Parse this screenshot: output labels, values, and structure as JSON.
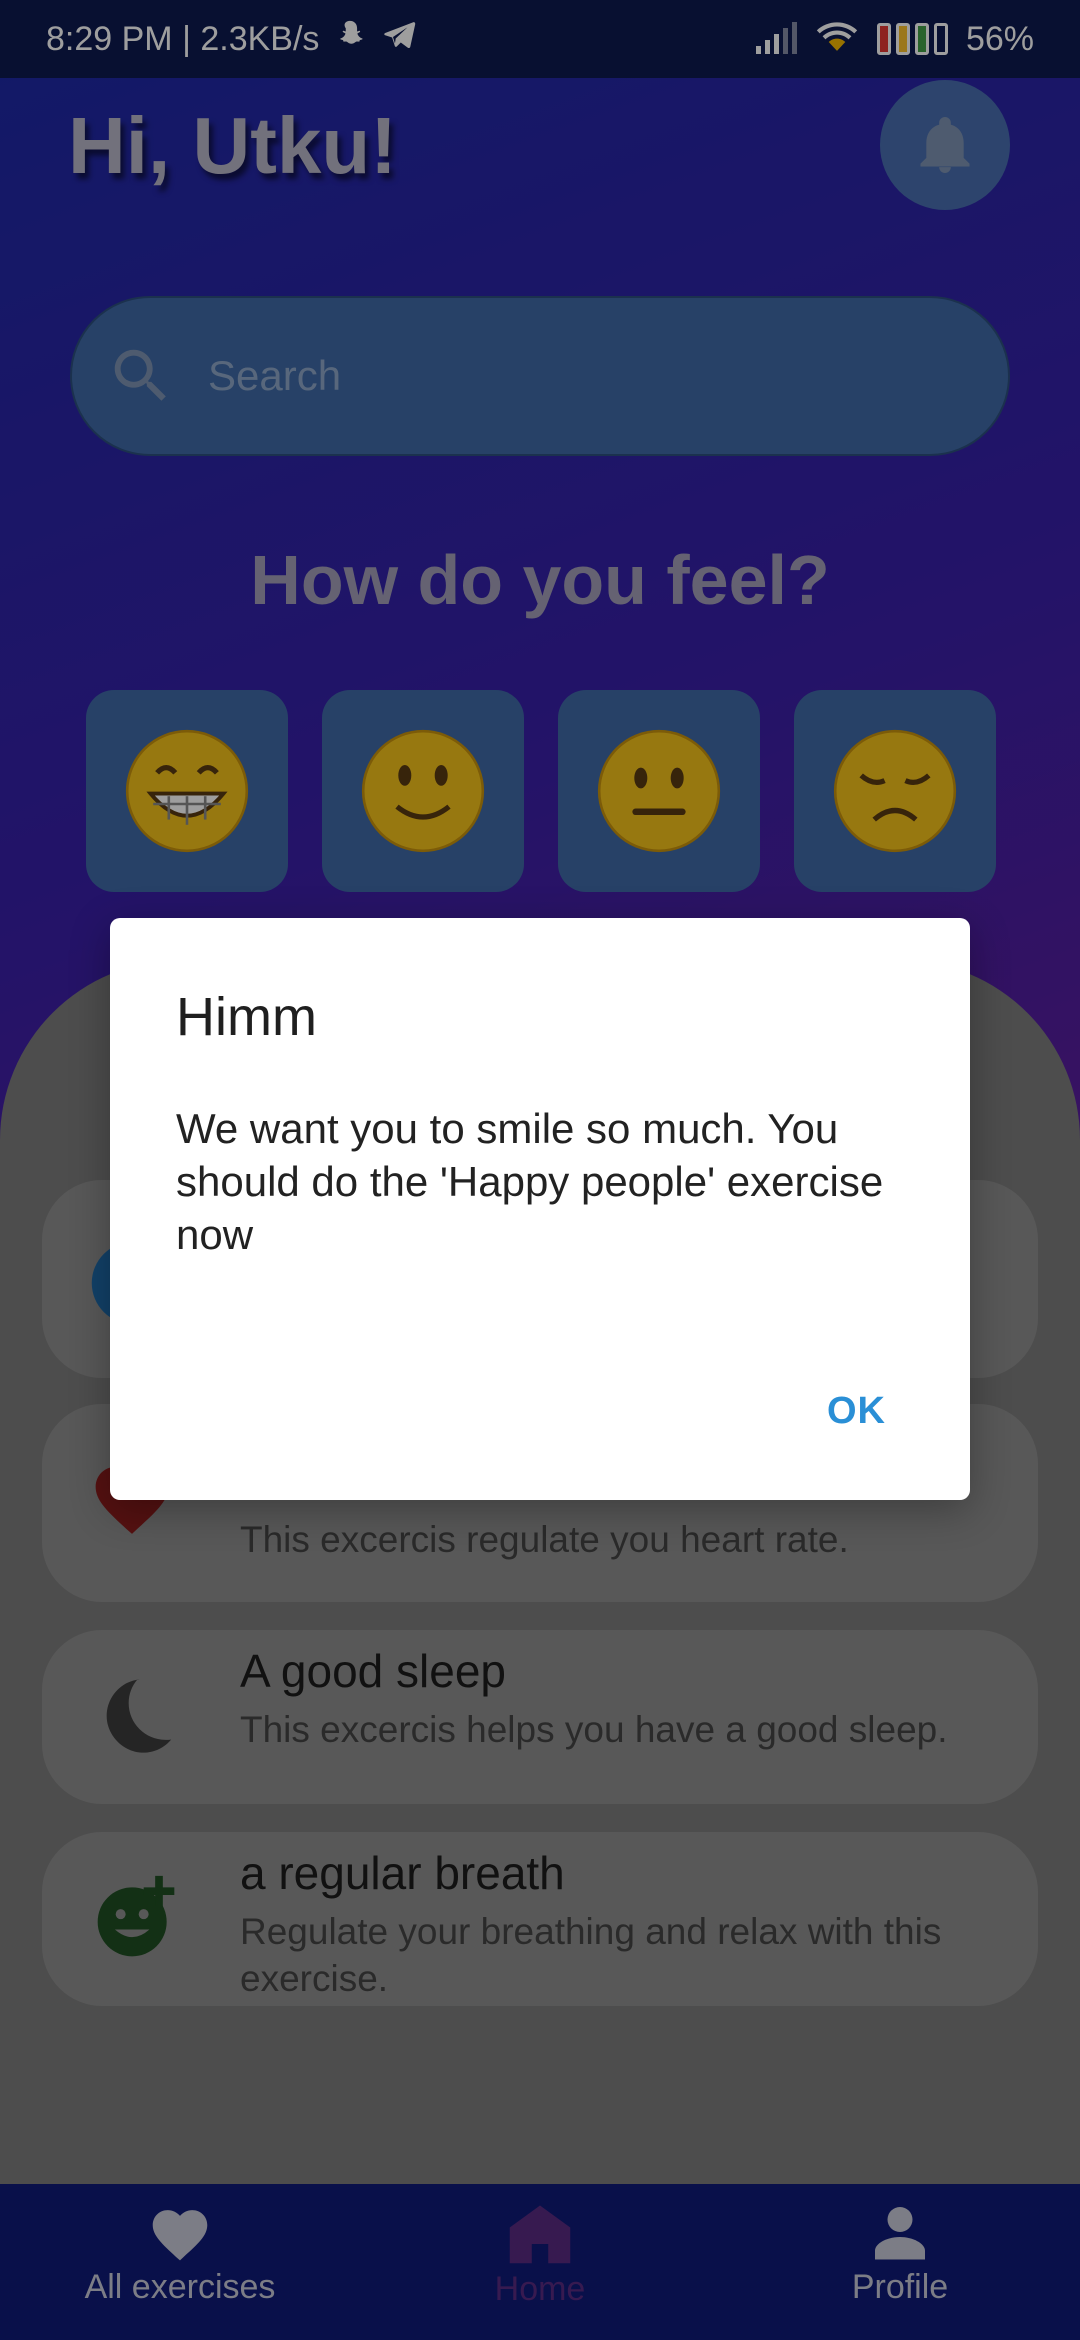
{
  "status_bar": {
    "time_speed": "8:29 PM | 2.3KB/s",
    "battery": "56%"
  },
  "header": {
    "greeting": "Hi, Utku!"
  },
  "search": {
    "placeholder": "Search"
  },
  "mood": {
    "title": "How do you feel?",
    "options": [
      "😁",
      "🙂",
      "😐",
      "😞"
    ]
  },
  "exercises": [
    {
      "title": "",
      "description": ""
    },
    {
      "title": "",
      "description": "This excercis regulate you heart rate."
    },
    {
      "title": "A good sleep",
      "description": "This excercis helps you have a good sleep."
    },
    {
      "title": "a regular breath",
      "description": "Regulate your breathing and relax with this exercise."
    }
  ],
  "dialog": {
    "title": "Himm",
    "message": "We want you to smile so much. You should do the 'Happy people' exercise now",
    "ok_label": "OK"
  },
  "bottom_nav": {
    "items": [
      {
        "label": "All exercises"
      },
      {
        "label": "Home"
      },
      {
        "label": "Profile"
      }
    ]
  },
  "colors": {
    "accent": "#2a8fd6",
    "heart": "#c62828",
    "breath": "#2e7d32"
  }
}
